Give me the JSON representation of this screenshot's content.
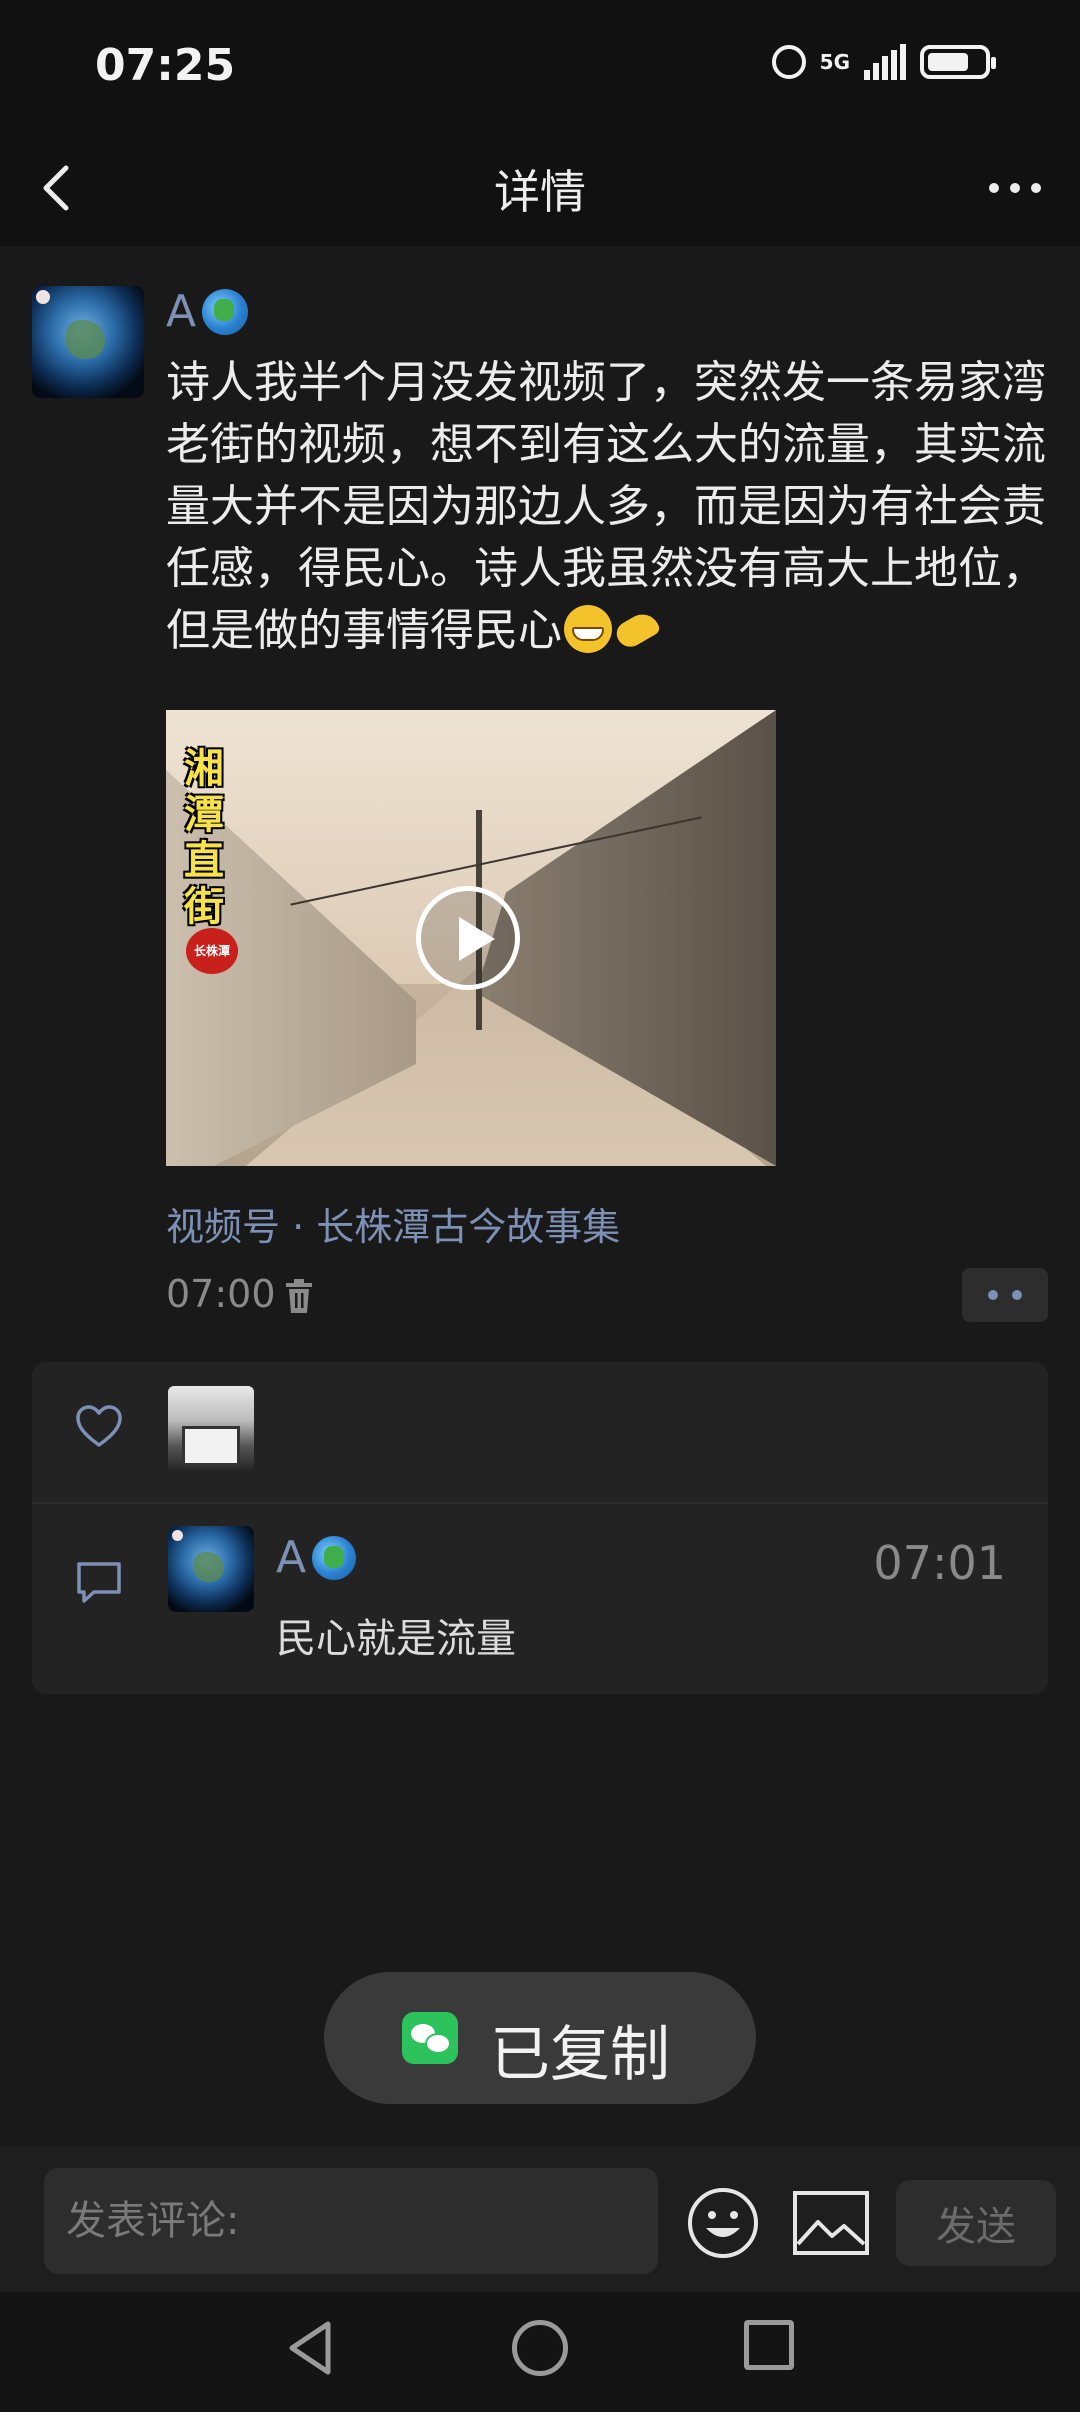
{
  "status_bar": {
    "time": "07:25",
    "network": "5G"
  },
  "nav": {
    "title": "详情"
  },
  "post": {
    "author": "A",
    "text": "诗人我半个月没发视频了，突然发一条易家湾老街的视频，想不到有这么大的流量，其实流量大并不是因为那边人多，而是因为有社会责任感，得民心。诗人我虽然没有高大上地位，但是做的事情得民心",
    "video_caption": "湘潭直街",
    "video_badge": "长株潭",
    "source": "视频号 · 长株潭古今故事集",
    "time": "07:00"
  },
  "comments": [
    {
      "author": "A",
      "time": "07:01",
      "text": "民心就是流量"
    }
  ],
  "toast": {
    "text": "已复制"
  },
  "input": {
    "placeholder": "发表评论:",
    "send_label": "发送"
  },
  "colors": {
    "background": "#191919",
    "link": "#7d90b5",
    "wechat_green": "#2dc35c"
  }
}
